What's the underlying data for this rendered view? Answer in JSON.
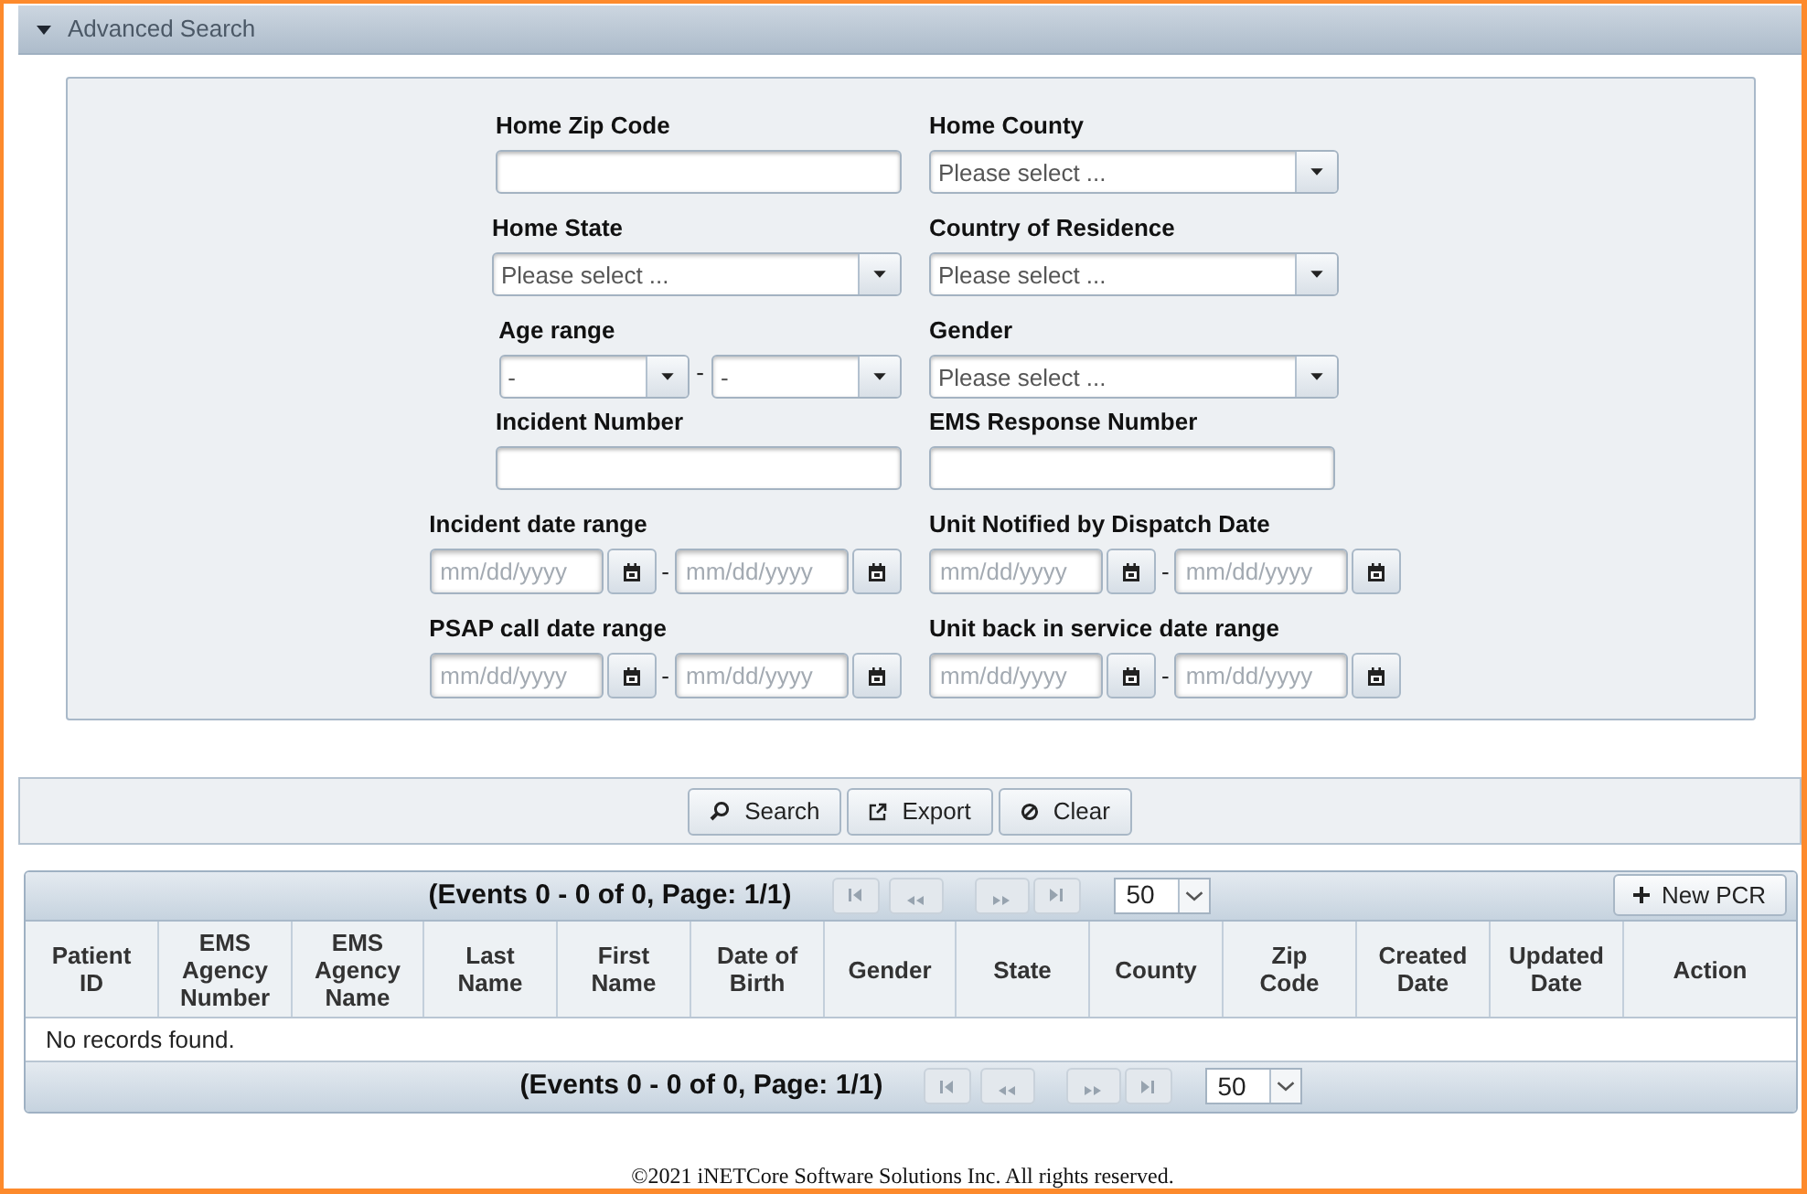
{
  "advanced_search": {
    "title": "Advanced Search",
    "expanded": true,
    "rows": [
      [
        {
          "kind": "text",
          "label": "Home Zip Code"
        },
        {
          "kind": "select",
          "label": "Home County",
          "value": "Please select ..."
        }
      ],
      [
        {
          "kind": "select",
          "label": "Home State",
          "value": "Please select ..."
        },
        {
          "kind": "select",
          "label": "Country of Residence",
          "value": "Please select ..."
        }
      ],
      [
        {
          "kind": "select_range",
          "label": "Age range",
          "from": {
            "value": "-"
          },
          "separator": "-",
          "to": {
            "value": "-"
          }
        },
        {
          "kind": "select",
          "label": "Gender",
          "value": "Please select ..."
        }
      ],
      [
        {
          "kind": "text",
          "label": "Incident Number"
        },
        {
          "kind": "text",
          "label": "EMS Response Number"
        }
      ],
      [
        {
          "kind": "date_range",
          "label": "Incident date range",
          "from": {
            "placeholder": "mm/dd/yyyy"
          },
          "separator": "-",
          "to": {
            "placeholder": "mm/dd/yyyy"
          }
        },
        {
          "kind": "date_range",
          "label": "Unit Notified by Dispatch Date",
          "from": {
            "placeholder": "mm/dd/yyyy"
          },
          "separator": "-",
          "to": {
            "placeholder": "mm/dd/yyyy"
          }
        }
      ],
      [
        {
          "kind": "date_range",
          "label": "PSAP call date range",
          "from": {
            "placeholder": "mm/dd/yyyy"
          },
          "separator": "-",
          "to": {
            "placeholder": "mm/dd/yyyy"
          }
        },
        {
          "kind": "date_range",
          "label": "Unit back in service date range",
          "from": {
            "placeholder": "mm/dd/yyyy"
          },
          "separator": "-",
          "to": {
            "placeholder": "mm/dd/yyyy"
          }
        }
      ]
    ]
  },
  "buttons": [
    "Search",
    "Export",
    "Clear"
  ],
  "results": {
    "top_bar": {
      "summary": "(Events 0 - 0 of 0, Page: 1/1)",
      "nav_buttons": [
        {
          "disabled": true
        },
        {
          "disabled": true
        },
        {
          "disabled": true
        },
        {
          "disabled": true
        }
      ],
      "page_size": "50",
      "new_button": "New PCR"
    },
    "columns": [
      "Patient ID",
      "EMS Agency Number",
      "EMS Agency Name",
      "Last Name",
      "First Name",
      "Date of Birth",
      "Gender",
      "State",
      "County",
      "Zip Code",
      "Created Date",
      "Updated Date",
      "Action"
    ],
    "empty_message": "No records found.",
    "bottom_bar": {
      "summary": "(Events 0 - 0 of 0, Page: 1/1)",
      "nav_buttons": [
        {
          "disabled": true
        },
        {
          "disabled": true
        },
        {
          "disabled": true
        },
        {
          "disabled": true
        }
      ],
      "page_size": "50"
    }
  },
  "footer": {
    "copyright": "©2021 iNETCore Software Solutions Inc. All rights reserved."
  }
}
